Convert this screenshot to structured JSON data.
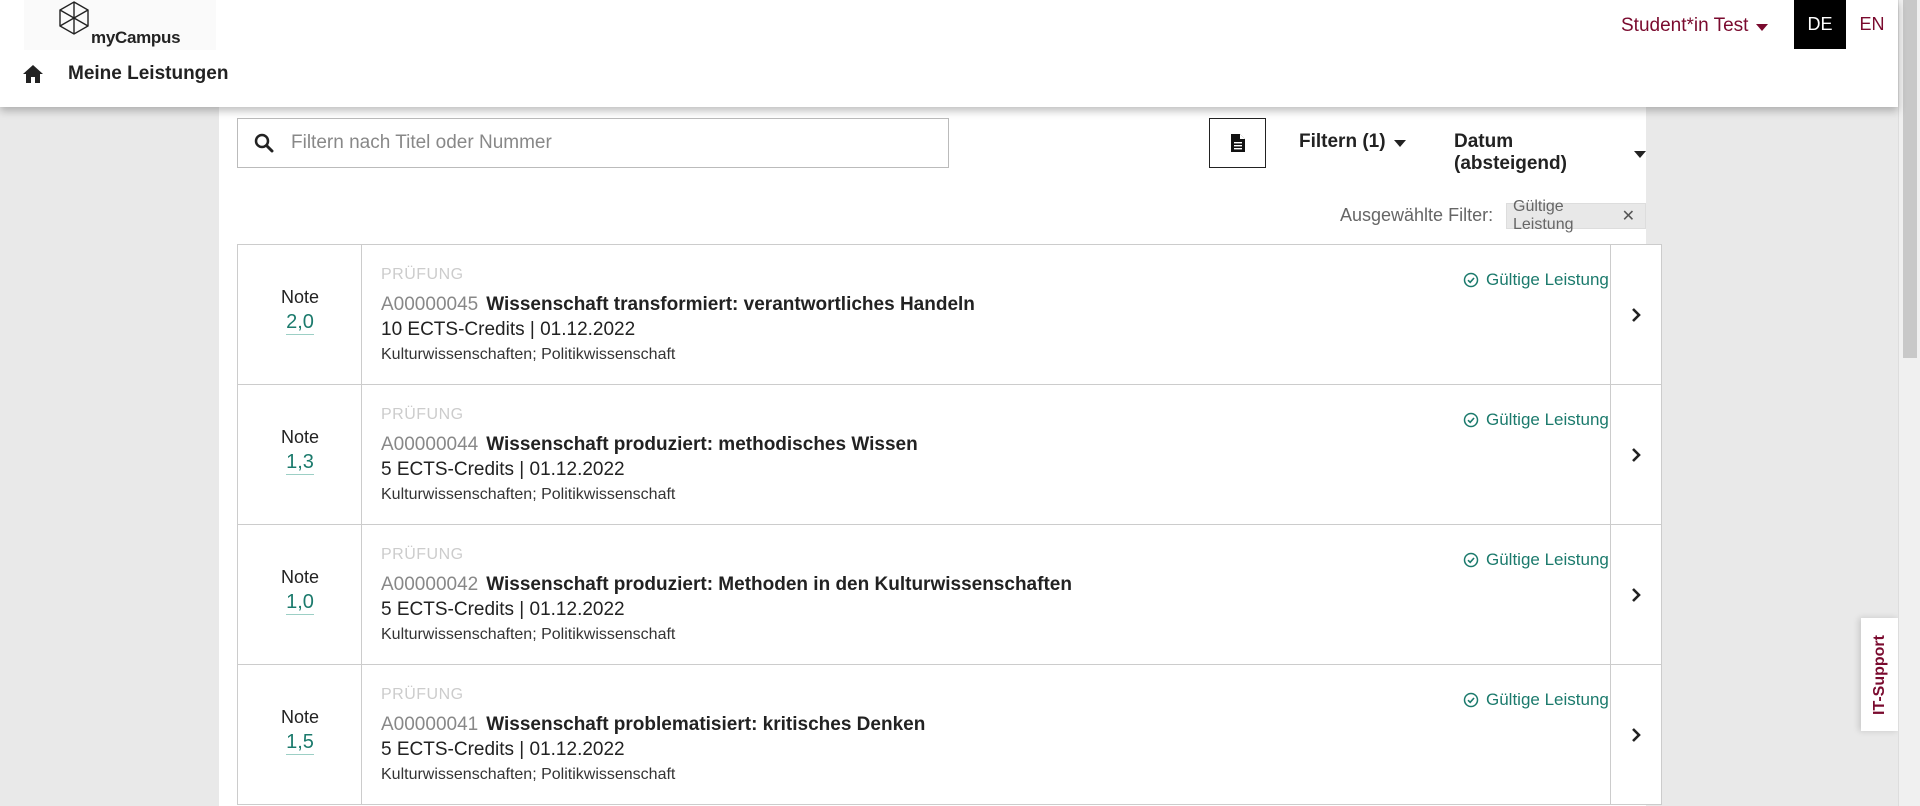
{
  "app": {
    "name": "myCampus"
  },
  "header": {
    "user_label": "Student*in Test",
    "lang_de": "DE",
    "lang_en": "EN",
    "page_title": "Meine Leistungen"
  },
  "toolbar": {
    "search_placeholder": "Filtern nach Titel oder Nummer",
    "filter_label": "Filtern (1)",
    "sort_label": "Datum (absteigend)",
    "active_filters_label": "Ausgewählte Filter:",
    "active_filter_chip": "Gültige Leistung"
  },
  "results": [
    {
      "grade_label": "Note",
      "grade": "2,0",
      "kind": "PRÜFUNG",
      "number": "A00000045",
      "title": "Wissenschaft transformiert: verantwortliches Handeln",
      "meta": "10 ECTS-Credits | 01.12.2022",
      "fields": "Kulturwissenschaften; Politikwissenschaft",
      "status": "Gültige Leistung"
    },
    {
      "grade_label": "Note",
      "grade": "1,3",
      "kind": "PRÜFUNG",
      "number": "A00000044",
      "title": "Wissenschaft produziert: methodisches Wissen",
      "meta": "5 ECTS-Credits | 01.12.2022",
      "fields": "Kulturwissenschaften; Politikwissenschaft",
      "status": "Gültige Leistung"
    },
    {
      "grade_label": "Note",
      "grade": "1,0",
      "kind": "PRÜFUNG",
      "number": "A00000042",
      "title": "Wissenschaft produziert: Methoden in den Kulturwissenschaften",
      "meta": "5 ECTS-Credits | 01.12.2022",
      "fields": "Kulturwissenschaften; Politikwissenschaft",
      "status": "Gültige Leistung"
    },
    {
      "grade_label": "Note",
      "grade": "1,5",
      "kind": "PRÜFUNG",
      "number": "A00000041",
      "title": "Wissenschaft problematisiert: kritisches Denken",
      "meta": "5 ECTS-Credits | 01.12.2022",
      "fields": "Kulturwissenschaften; Politikwissenschaft",
      "status": "Gültige Leistung"
    }
  ],
  "support": {
    "label": "IT-Support"
  },
  "icons": {
    "logo": "cube-logo-icon",
    "home": "home-icon",
    "search": "search-icon",
    "pdf": "document-icon",
    "status": "check-circle-icon",
    "arrow": "chevron-right-icon",
    "close": "close-icon"
  },
  "colors": {
    "brand": "#7a0a2e",
    "accent": "#1b7a6c",
    "lang_active_bg": "#000000"
  }
}
